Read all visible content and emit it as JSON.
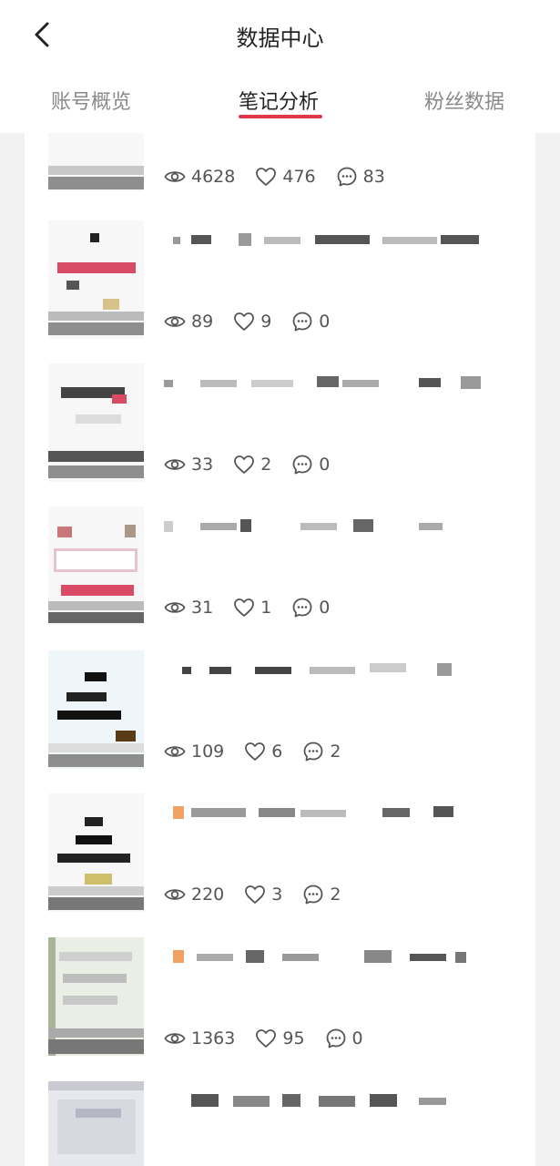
{
  "header": {
    "title": "数据中心"
  },
  "tabs": [
    {
      "label": "账号概览",
      "active": false
    },
    {
      "label": "笔记分析",
      "active": true
    },
    {
      "label": "粉丝数据",
      "active": false
    }
  ],
  "accent_color": "#e0394a",
  "notes": [
    {
      "views": "4628",
      "likes": "476",
      "comments": "83"
    },
    {
      "views": "89",
      "likes": "9",
      "comments": "0"
    },
    {
      "views": "33",
      "likes": "2",
      "comments": "0"
    },
    {
      "views": "31",
      "likes": "1",
      "comments": "0"
    },
    {
      "views": "109",
      "likes": "6",
      "comments": "2"
    },
    {
      "views": "220",
      "likes": "3",
      "comments": "2"
    },
    {
      "views": "1363",
      "likes": "95",
      "comments": "0"
    },
    {
      "views": "",
      "likes": "",
      "comments": ""
    }
  ],
  "icons": {
    "back": "chevron-left-icon",
    "views": "eye-icon",
    "likes": "heart-icon",
    "comments": "comment-icon"
  }
}
